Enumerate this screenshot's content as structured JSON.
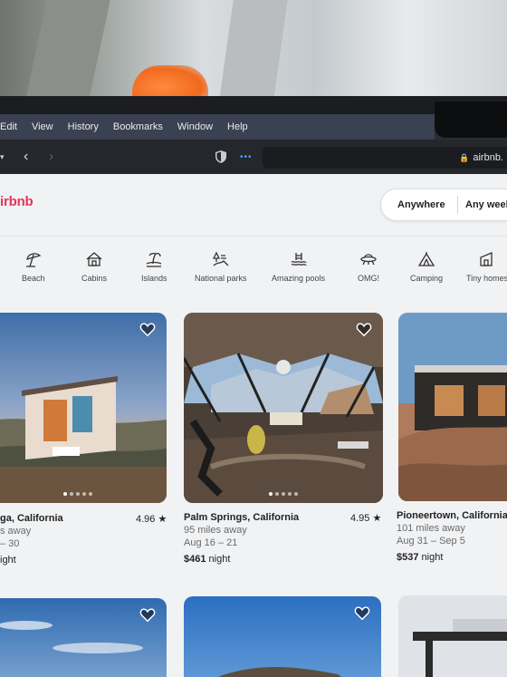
{
  "menu": [
    "Edit",
    "View",
    "History",
    "Bookmarks",
    "Window",
    "Help"
  ],
  "browser": {
    "url": "airbnb."
  },
  "site": {
    "logo": "irbnb"
  },
  "search": {
    "where": "Anywhere",
    "when": "Any week"
  },
  "categories": [
    {
      "label": "Beach",
      "icon": "umbrella-icon"
    },
    {
      "label": "Cabins",
      "icon": "cabin-icon"
    },
    {
      "label": "Islands",
      "icon": "island-icon"
    },
    {
      "label": "National parks",
      "icon": "national-park-icon"
    },
    {
      "label": "Amazing pools",
      "icon": "pool-icon"
    },
    {
      "label": "OMG!",
      "icon": "ufo-icon"
    },
    {
      "label": "Camping",
      "icon": "tent-icon"
    },
    {
      "label": "Tiny homes",
      "icon": "tiny-home-icon"
    }
  ],
  "listings": [
    {
      "title": "ga, California",
      "rating": "4.96",
      "distance": "s away",
      "dates": "– 30",
      "price": "",
      "price_suffix": "ight"
    },
    {
      "title": "Palm Springs, California",
      "rating": "4.95",
      "distance": "95 miles away",
      "dates": "Aug 16 – 21",
      "price": "$461",
      "price_suffix": " night"
    },
    {
      "title": "Pioneertown, California",
      "rating": "",
      "distance": "101 miles away",
      "dates": "Aug 31 – Sep 5",
      "price": "$537",
      "price_suffix": " night"
    }
  ],
  "colors": {
    "brand": "#e4355c",
    "menubar": "#3a4150",
    "toolbar": "#24272c",
    "page": "#f1f2f4"
  }
}
